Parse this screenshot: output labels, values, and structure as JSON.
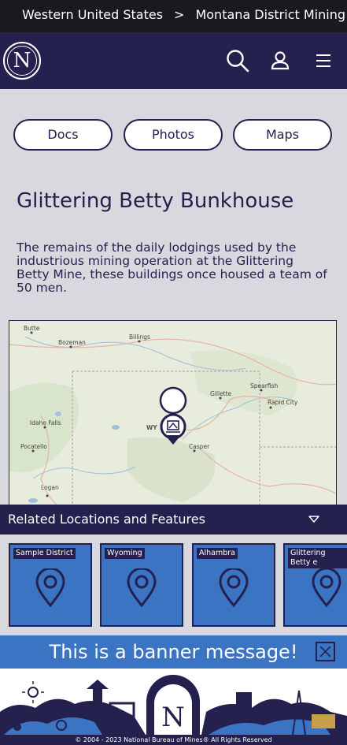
{
  "breadcrumb": {
    "items": [
      "Western United States",
      "Montana District Mining D"
    ],
    "separator": ">"
  },
  "header": {
    "logo_letter": "N",
    "icons": [
      "search-icon",
      "user-icon",
      "menu-icon"
    ]
  },
  "tabs": [
    {
      "label": "Docs"
    },
    {
      "label": "Photos"
    },
    {
      "label": "Maps"
    }
  ],
  "main": {
    "title": "Glittering Betty Bunkhouse",
    "description": "The remains of the daily lodgings used by the industrious mining operation at the Glittering Betty Mine, these buildings once housed a team of 50 men."
  },
  "map": {
    "cities": [
      "Butte",
      "Bozeman",
      "Billings",
      "Gillette",
      "Spearfish",
      "Rapid City",
      "Idaho Falls",
      "Pocatello",
      "Casper",
      "Logan"
    ],
    "state_label": "WY"
  },
  "related": {
    "title": "Related Locations and Features",
    "cards": [
      {
        "label": "Sample District"
      },
      {
        "label": "Wyoming"
      },
      {
        "label": "Alhambra"
      },
      {
        "label": "Glittering Betty e"
      }
    ]
  },
  "banner": {
    "message": "This is a banner message!"
  },
  "footer": {
    "copyright": "© 2004 - 2023 National Bureau of Mines® All Rights Reserved"
  },
  "colors": {
    "navy": "#24214f",
    "blue": "#3a74c3",
    "background": "#d8d9df"
  }
}
